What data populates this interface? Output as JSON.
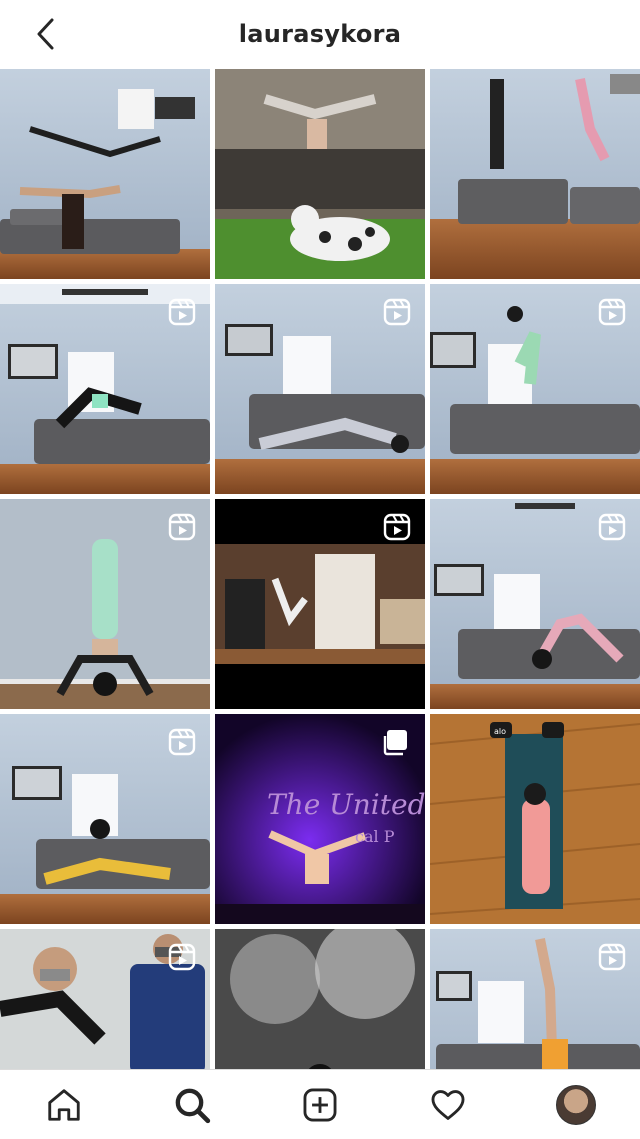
{
  "header": {
    "title": "laurasykora",
    "back_icon": "chevron-left-icon"
  },
  "grid": {
    "tiles": [
      {
        "id": "t1",
        "badge": "none"
      },
      {
        "id": "t2",
        "badge": "none"
      },
      {
        "id": "t3",
        "badge": "none"
      },
      {
        "id": "t4",
        "badge": "reels-icon"
      },
      {
        "id": "t5",
        "badge": "reels-icon"
      },
      {
        "id": "t6",
        "badge": "reels-icon"
      },
      {
        "id": "t7",
        "badge": "reels-icon"
      },
      {
        "id": "t8",
        "badge": "reels-icon"
      },
      {
        "id": "t9",
        "badge": "reels-icon"
      },
      {
        "id": "t10",
        "badge": "reels-icon"
      },
      {
        "id": "t11",
        "badge": "carousel-icon",
        "overlay_text": "The United S",
        "overlay_subtext": "cal P"
      },
      {
        "id": "t12",
        "badge": "none",
        "mat_brand": "alo"
      },
      {
        "id": "t13",
        "badge": "reels-icon"
      },
      {
        "id": "t14",
        "badge": "none"
      },
      {
        "id": "t15",
        "badge": "reels-icon"
      }
    ]
  },
  "tabbar": {
    "items": [
      "home-icon",
      "search-icon",
      "add-post-icon",
      "heart-icon",
      "profile-avatar"
    ],
    "active": "search-icon"
  },
  "colors": {
    "text": "#262626",
    "wall": "#a9b7c8",
    "floor": "#9a5a2e",
    "sofa": "#5f5f5f"
  }
}
